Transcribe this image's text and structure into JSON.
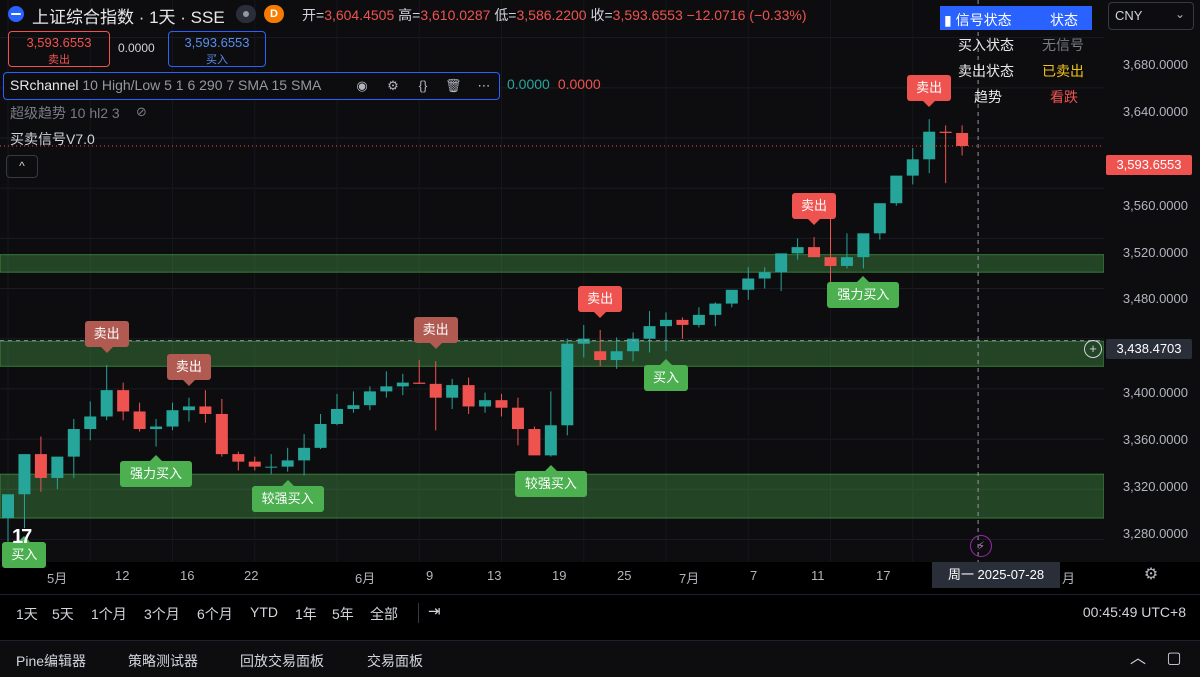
{
  "header": {
    "title": "上证综合指数 · 1天 · SSE",
    "badge": "D",
    "ohlc": {
      "open_label": "开=",
      "open": "3,604.4505",
      "high_label": "高=",
      "high": "3,610.0287",
      "low_label": "低=",
      "low": "3,586.2200",
      "close_label": "收=",
      "close": "3,593.6553",
      "change": "−12.0716 (−0.33%)"
    }
  },
  "trade": {
    "sell_price": "3,593.6553",
    "sell_label": "卖出",
    "spread": "0.0000",
    "buy_price": "3,593.6553",
    "buy_label": "买入"
  },
  "indicators": {
    "sr_name": "SRchannel",
    "sr_params": "10 High/Low 5 1 6 290 7 SMA 15 SMA",
    "sr_val1": "0.0000",
    "sr_val2": "0.0000",
    "ind2": "超级趋势 10 hl2 3",
    "ind3": "买卖信号V7.0"
  },
  "currency": "CNY",
  "status_table": {
    "header": [
      "信号状态",
      "状态"
    ],
    "rows": [
      {
        "key": "买入状态",
        "value": "无信号",
        "color": "#787b86"
      },
      {
        "key": "卖出状态",
        "value": "已卖出",
        "color": "#f0c419"
      },
      {
        "key": "趋势",
        "value": "看跌",
        "color": "#ef5350"
      }
    ]
  },
  "price_scale": {
    "labels": [
      "3,680.0000",
      "3,640.0000",
      "3,560.0000",
      "3,520.0000",
      "3,480.0000",
      "3,400.0000",
      "3,360.0000",
      "3,320.0000",
      "3,280.0000"
    ],
    "current_price": "3,593.6553",
    "crosshair_price": "3,438.4703"
  },
  "time_axis": {
    "labels": [
      "5月",
      "12",
      "16",
      "22",
      "6月",
      "9",
      "13",
      "19",
      "25",
      "7月",
      "7",
      "11",
      "17",
      "月"
    ],
    "crosshair_date": "周一 2025-07-28"
  },
  "chart_data": {
    "type": "candlestick",
    "x": [
      "05-06",
      "05-07",
      "05-08",
      "05-09",
      "05-12",
      "05-13",
      "05-14",
      "05-15",
      "05-16",
      "05-19",
      "05-20",
      "05-21",
      "05-22",
      "05-23",
      "05-26",
      "05-27",
      "05-28",
      "05-29",
      "05-30",
      "06-03",
      "06-04",
      "06-05",
      "06-06",
      "06-09",
      "06-10",
      "06-11",
      "06-12",
      "06-13",
      "06-16",
      "06-17",
      "06-18",
      "06-19",
      "06-20",
      "06-23",
      "06-24",
      "06-25",
      "06-26",
      "06-27",
      "06-30",
      "07-01",
      "07-02",
      "07-03",
      "07-04",
      "07-07",
      "07-08",
      "07-09",
      "07-10",
      "07-11",
      "07-14",
      "07-15",
      "07-16",
      "07-17",
      "07-18",
      "07-21",
      "07-22",
      "07-23",
      "07-24",
      "07-25",
      "07-28"
    ],
    "open": [
      3297,
      3316,
      3348,
      3329,
      3346,
      3368,
      3378,
      3399,
      3382,
      3368,
      3370,
      3383,
      3386,
      3380,
      3348,
      3342,
      3338,
      3338,
      3343,
      3353,
      3372,
      3384,
      3387,
      3398,
      3402,
      3405,
      3404,
      3393,
      3403,
      3386,
      3391,
      3385,
      3368,
      3347,
      3371,
      3436,
      3430,
      3423,
      3430,
      3440,
      3450,
      3455,
      3451,
      3459,
      3468,
      3479,
      3488,
      3493,
      3508,
      3513,
      3505,
      3498,
      3505,
      3524,
      3548,
      3570,
      3583,
      3605,
      3604
    ],
    "high": [
      3302,
      3345,
      3362,
      3337,
      3376,
      3390,
      3419,
      3405,
      3389,
      3376,
      3389,
      3393,
      3399,
      3392,
      3350,
      3346,
      3348,
      3353,
      3364,
      3380,
      3396,
      3398,
      3402,
      3414,
      3412,
      3423,
      3422,
      3408,
      3409,
      3397,
      3396,
      3393,
      3370,
      3398,
      3440,
      3451,
      3447,
      3441,
      3445,
      3462,
      3461,
      3457,
      3465,
      3469,
      3470,
      3497,
      3497,
      3502,
      3520,
      3521,
      3538,
      3524,
      3509,
      3538,
      3561,
      3592,
      3615,
      3610,
      3610
    ],
    "low": [
      3278,
      3289,
      3318,
      3320,
      3329,
      3359,
      3375,
      3375,
      3366,
      3354,
      3367,
      3374,
      3373,
      3346,
      3335,
      3335,
      3332,
      3334,
      3331,
      3352,
      3371,
      3381,
      3383,
      3393,
      3395,
      3404,
      3367,
      3384,
      3380,
      3381,
      3378,
      3355,
      3351,
      3346,
      3363,
      3425,
      3418,
      3416,
      3422,
      3429,
      3430,
      3440,
      3449,
      3450,
      3465,
      3471,
      3480,
      3478,
      3503,
      3506,
      3482,
      3496,
      3496,
      3519,
      3546,
      3563,
      3572,
      3564,
      3586
    ],
    "close": [
      3316,
      3348,
      3329,
      3346,
      3368,
      3378,
      3399,
      3382,
      3368,
      3370,
      3383,
      3386,
      3380,
      3348,
      3342,
      3338,
      3338,
      3343,
      3353,
      3372,
      3384,
      3387,
      3398,
      3402,
      3405,
      3404,
      3393,
      3403,
      3386,
      3391,
      3385,
      3368,
      3347,
      3371,
      3436,
      3440,
      3423,
      3430,
      3440,
      3450,
      3455,
      3451,
      3459,
      3468,
      3479,
      3488,
      3493,
      3508,
      3513,
      3505,
      3498,
      3505,
      3524,
      3548,
      3570,
      3583,
      3605,
      3604,
      3593.6553
    ],
    "ylim": [
      3262,
      3710
    ],
    "sr_zones": [
      [
        3493,
        3507
      ],
      [
        3418,
        3438
      ],
      [
        3297,
        3332
      ]
    ],
    "current_price": 3593.6553,
    "crosshair_price": 3438.4703,
    "signals": [
      {
        "type": "sell",
        "label": "卖出",
        "x": "05-14"
      },
      {
        "type": "sell",
        "label": "卖出",
        "x": "05-21"
      },
      {
        "type": "sell",
        "label": "卖出",
        "x": "06-12"
      },
      {
        "type": "sell",
        "label": "卖出",
        "x": "06-26"
      },
      {
        "type": "sell",
        "label": "卖出",
        "x": "07-15"
      },
      {
        "type": "sell",
        "label": "卖出",
        "x": "07-24"
      },
      {
        "type": "buy",
        "label": "买入",
        "x": "05-07"
      },
      {
        "type": "buy",
        "label": "强力买入",
        "x": "05-19"
      },
      {
        "type": "buy",
        "label": "较强买入",
        "x": "05-29"
      },
      {
        "type": "buy",
        "label": "较强买入",
        "x": "06-23"
      },
      {
        "type": "buy",
        "label": "买入",
        "x": "07-02"
      },
      {
        "type": "buy",
        "label": "强力买入",
        "x": "07-18"
      }
    ]
  },
  "range_buttons": [
    "1天",
    "5天",
    "1个月",
    "3个月",
    "6个月",
    "YTD",
    "1年",
    "5年",
    "全部"
  ],
  "clock": "00:45:49 UTC+8",
  "bottom_tabs": [
    "Pine编辑器",
    "策略测试器",
    "回放交易面板",
    "交易面板"
  ]
}
